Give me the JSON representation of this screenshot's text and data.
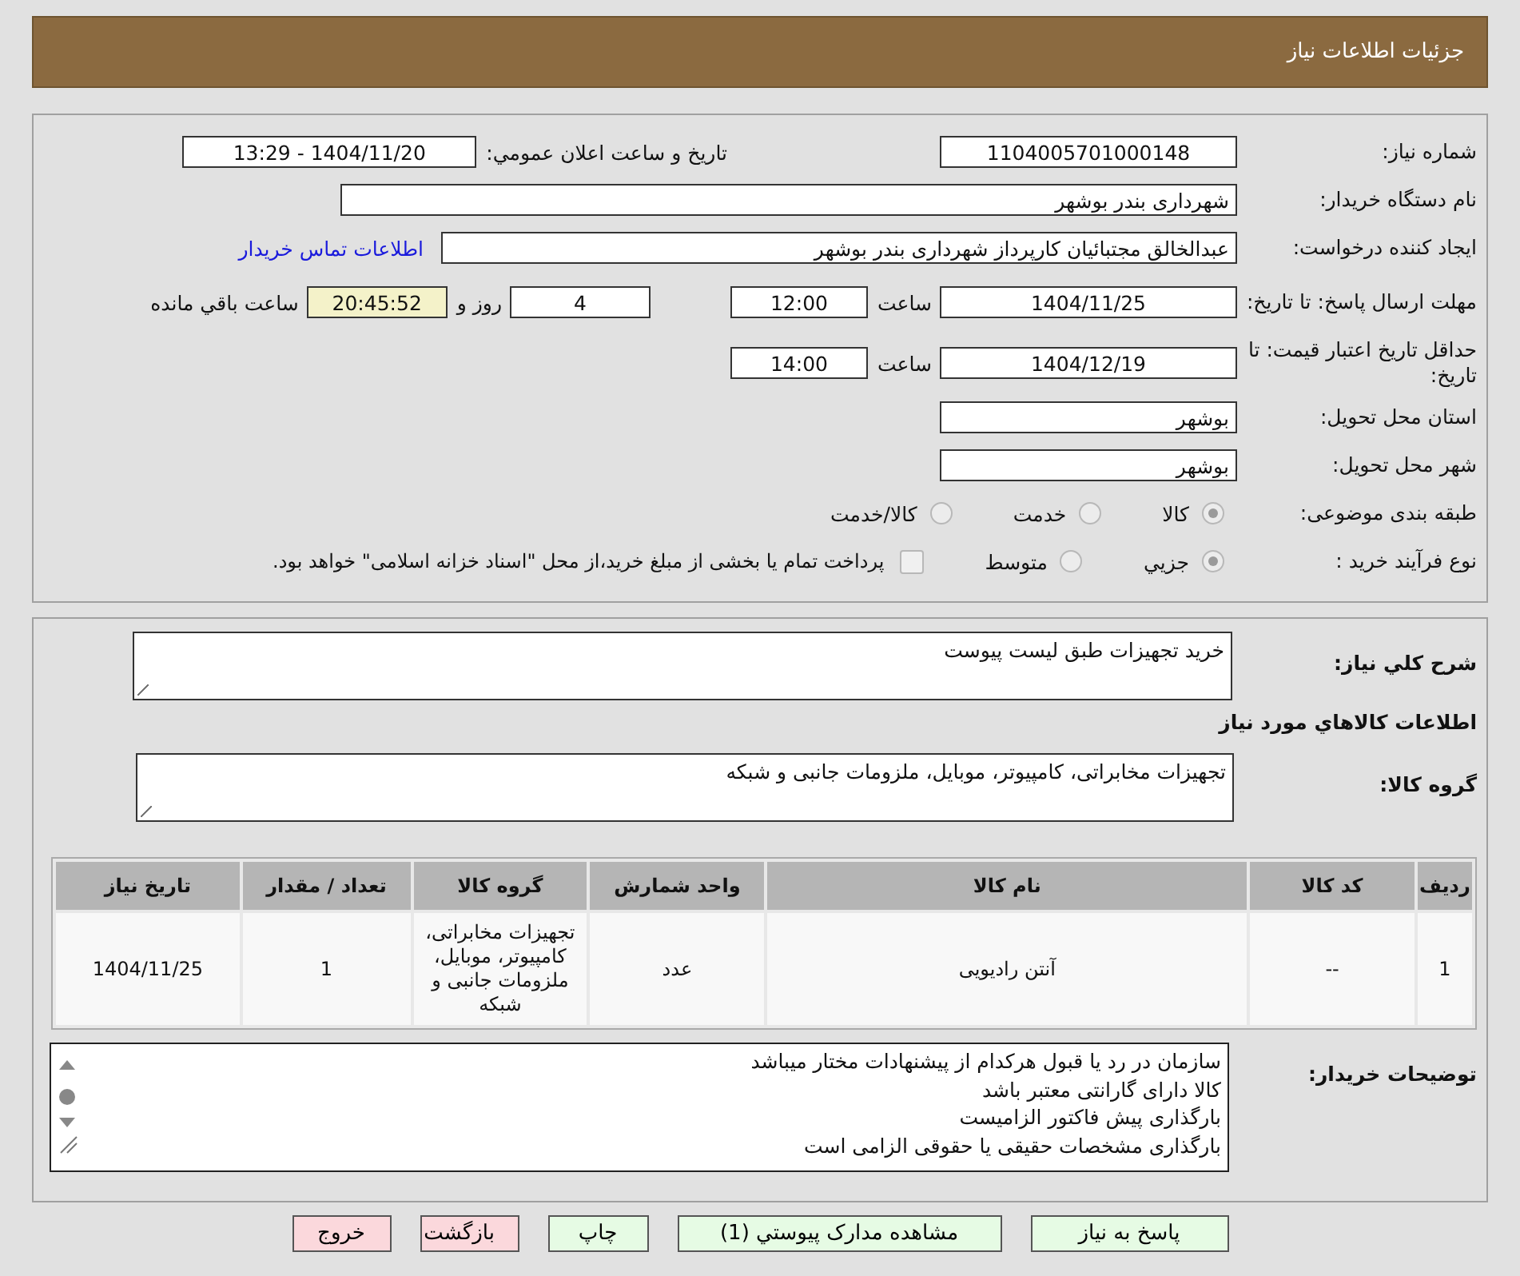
{
  "header": {
    "title": "جزئیات اطلاعات نیاز"
  },
  "details": {
    "need_number": {
      "label": "شماره نیاز:",
      "value": "1104005701000148"
    },
    "announce": {
      "label": "تاریخ و ساعت اعلان عمومي:",
      "value": "1404/11/20 - 13:29"
    },
    "buyer_org": {
      "label": "نام دستگاه خریدار:",
      "value": "شهرداری بندر بوشهر"
    },
    "requester": {
      "label": "ایجاد کننده درخواست:",
      "value": "عبدالخالق مجتبائیان کارپرداز شهرداری بندر بوشهر",
      "link": "اطلاعات تماس خریدار"
    },
    "deadline": {
      "label": "مهلت ارسال پاسخ: تا تاریخ:",
      "date": "1404/11/25",
      "time_label": "ساعت",
      "time": "12:00",
      "days": "4",
      "days_label": "روز و",
      "remaining": "20:45:52",
      "remaining_label": "ساعت باقي مانده"
    },
    "validity": {
      "label": "حداقل تاریخ اعتبار قیمت: تا تاریخ:",
      "date": "1404/12/19",
      "time_label": "ساعت",
      "time": "14:00"
    },
    "province": {
      "label": "استان محل تحویل:",
      "value": "بوشهر"
    },
    "city": {
      "label": "شهر محل تحویل:",
      "value": "بوشهر"
    },
    "category": {
      "label": "طبقه بندی موضوعی:",
      "options": [
        {
          "label": "کالا",
          "selected": true
        },
        {
          "label": "خدمت",
          "selected": false
        },
        {
          "label": "کالا/خدمت",
          "selected": false
        }
      ]
    },
    "process": {
      "label": "نوع فرآیند خرید :",
      "options": [
        {
          "label": "جزيي",
          "selected": true
        },
        {
          "label": "متوسط",
          "selected": false
        }
      ],
      "treasury": {
        "checked": false,
        "text": "پرداخت تمام یا بخشی از مبلغ خرید،از محل \"اسناد خزانه اسلامی\" خواهد بود."
      }
    }
  },
  "need": {
    "summary": {
      "label": "شرح كلي نياز:",
      "value": "خرید تجهیزات طبق لیست پیوست"
    },
    "goods_heading": "اطلاعات كالاهاي مورد نياز",
    "goods_group": {
      "label": "گروه کالا:",
      "value": "تجهیزات مخابراتی، کامپیوتر، موبایل، ملزومات جانبی و شبکه"
    },
    "table": {
      "columns": [
        "ردیف",
        "کد کالا",
        "نام کالا",
        "واحد شمارش",
        "گروه کالا",
        "تعداد / مقدار",
        "تاریخ نیاز"
      ],
      "rows": [
        [
          "1",
          "--",
          "آنتن رادیویی",
          "عدد",
          "تجهیزات مخابراتی، کامپیوتر، موبایل، ملزومات جانبی و شبکه",
          "1",
          "1404/11/25"
        ]
      ]
    },
    "notes": {
      "label": "توضیحات خریدار:",
      "lines": [
        "سازمان در رد یا قبول هرکدام از پیشنهادات مختار میباشد",
        "کالا دارای گارانتی معتبر باشد",
        "بارگذاری پیش فاکتور الزامیست",
        "بارگذاری مشخصات حقیقی یا حقوقی الزامی است"
      ]
    }
  },
  "buttons": [
    {
      "label": "پاسخ به نیاز",
      "kind": "primary"
    },
    {
      "label": "مشاهده مدارک پیوستي (1)",
      "kind": "primary"
    },
    {
      "label": "چاپ",
      "kind": "primary"
    },
    {
      "label": "بازگشت",
      "kind": "danger"
    },
    {
      "label": "خروج",
      "kind": "danger"
    }
  ]
}
